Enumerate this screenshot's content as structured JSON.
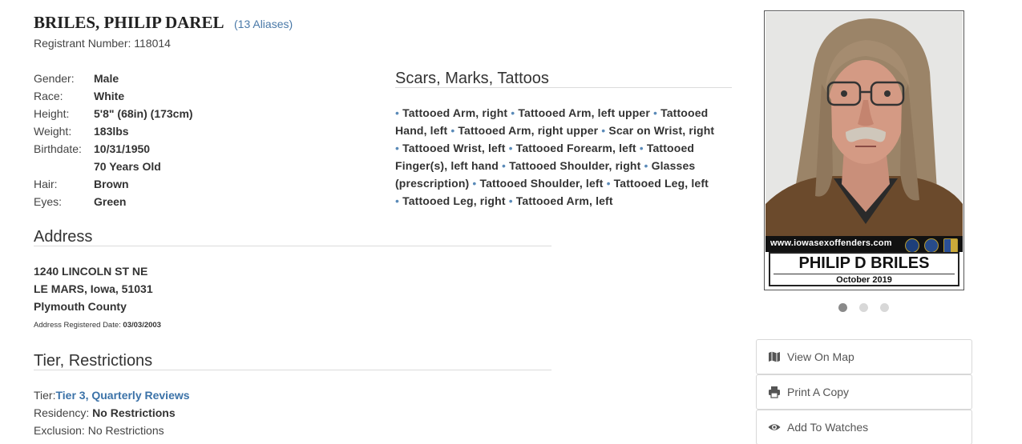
{
  "registrant": {
    "name": "BRILES, PHILIP DAREL",
    "aliases": "(13 Aliases)",
    "registrant_number": "Registrant Number: 118014"
  },
  "details": [
    {
      "label": "Gender:",
      "value": "Male"
    },
    {
      "label": "Race:",
      "value": "White"
    },
    {
      "label": "Height:",
      "value": "5'8\" (68in) (173cm)"
    },
    {
      "label": "Weight:",
      "value": "183lbs"
    },
    {
      "label": "Birthdate:",
      "value": "10/31/1950"
    },
    {
      "label": "",
      "value": "70 Years Old"
    },
    {
      "label": "Hair:",
      "value": "Brown"
    },
    {
      "label": "Eyes:",
      "value": "Green"
    }
  ],
  "smt": {
    "title": "Scars, Marks, Tattoos",
    "items": [
      "Tattooed Arm, right",
      "Tattooed Arm, left upper",
      "Tattooed Hand, left",
      "Tattooed Arm, right upper",
      "Scar on Wrist, right",
      "Tattooed Wrist, left",
      "Tattooed Forearm, left",
      "Tattooed Finger(s), left hand",
      "Tattooed Shoulder, right",
      "Glasses (prescription)",
      "Tattooed Shoulder, left",
      "Tattooed Leg, left",
      "Tattooed Leg, right",
      "Tattooed Arm, left"
    ],
    "bullet": "•"
  },
  "address": {
    "title": "Address",
    "street": "1240 LINCOLN ST NE",
    "city": "LE MARS, Iowa, 51031",
    "county": "Plymouth County",
    "registered_label": "Address Registered Date:",
    "registered_date": "03/03/2003"
  },
  "tier": {
    "title": "Tier, Restrictions",
    "tier_label": "Tier:",
    "tier_value": "Tier 3, Quarterly Reviews",
    "residency_label": "Residency:",
    "residency_value": "No Restrictions",
    "exclusion_label": "Exclusion:",
    "exclusion_value": "No Restrictions"
  },
  "photo": {
    "site": "www.iowasexoffenders.com",
    "card_name": "PHILIP D BRILES",
    "card_date": "October 2019",
    "active_slide": 1,
    "slide_count": 3
  },
  "actions": [
    {
      "label": "View On Map",
      "icon": "map-icon"
    },
    {
      "label": "Print A Copy",
      "icon": "print-icon"
    },
    {
      "label": "Add To Watches",
      "icon": "eye-icon"
    }
  ],
  "colors": {
    "link": "#4a79a8",
    "tier_link": "#3b72a8",
    "bullet": "#5a8ab8",
    "dot_active": "#8a8a8a",
    "dot_inactive": "#d8d8d8"
  }
}
